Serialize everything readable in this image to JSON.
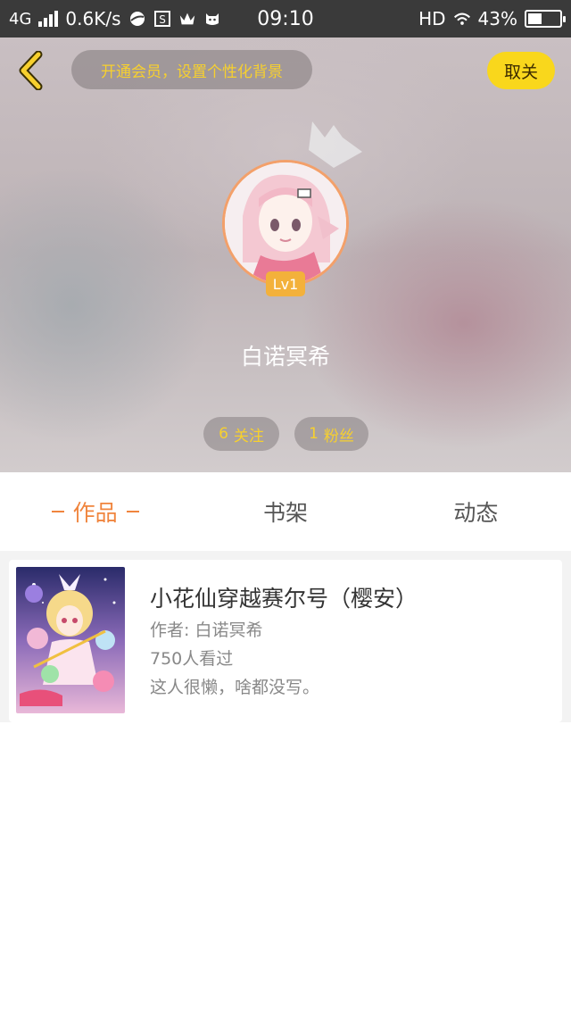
{
  "status_bar": {
    "network": "4G",
    "speed": "0.6K/s",
    "time": "09:10",
    "hd": "HD",
    "battery": "43%",
    "battery_level": 0.43
  },
  "header": {
    "vip_prompt": "开通会员，设置个性化背景",
    "cancel_label": "取关",
    "level": "Lv1",
    "username": "白诺冥希",
    "follow_count": "6",
    "follow_label": "关注",
    "fans_count": "1",
    "fans_label": "粉丝"
  },
  "tabs": [
    {
      "label": "作品",
      "active": true
    },
    {
      "label": "书架",
      "active": false
    },
    {
      "label": "动态",
      "active": false
    }
  ],
  "works": [
    {
      "title": "小花仙穿越赛尔号（樱安）",
      "author": "作者: 白诺冥希",
      "views": "750人看过",
      "description": "这人很懒，啥都没写。"
    }
  ],
  "colors": {
    "accent_orange": "#f0853e",
    "accent_yellow": "#f7d02e",
    "status_bar": "#3a3a3a"
  },
  "icons": {
    "back": "chevron-left-icon",
    "crown": "crown-icon"
  }
}
